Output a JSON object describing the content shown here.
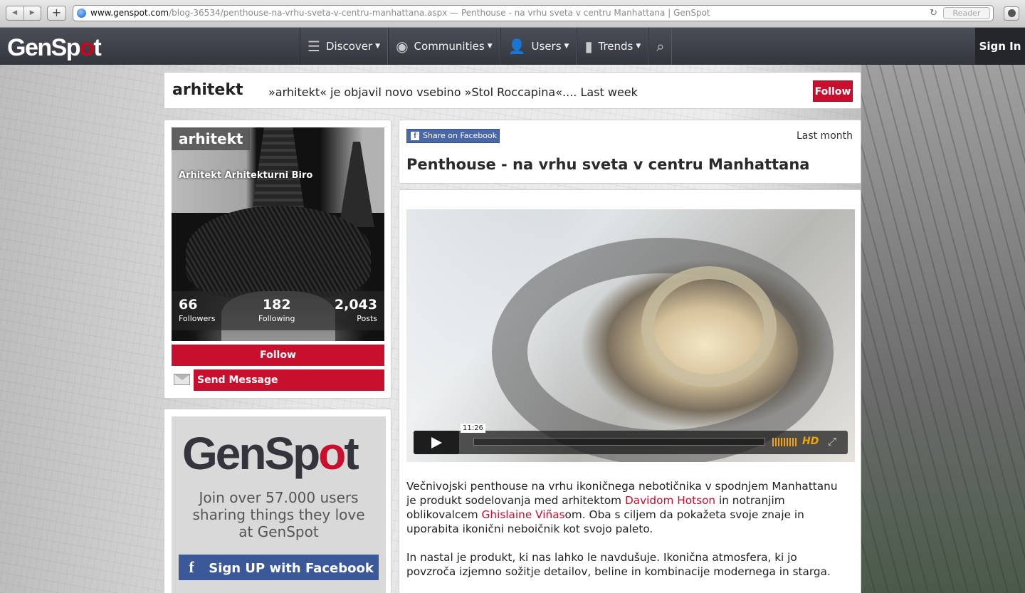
{
  "browser": {
    "url_host": "www.genspot.com",
    "url_rest": "/blog-36534/penthouse-na-vrhu-sveta-v-centru-manhattana.aspx — Penthouse - na vrhu sveta v centru Manhattana | GenSpot",
    "reader_label": "Reader"
  },
  "site_nav": {
    "logo": "GenSpot",
    "items": [
      {
        "label": "Discover",
        "icon": "menu-icon"
      },
      {
        "label": "Communities",
        "icon": "circle-icon"
      },
      {
        "label": "Users",
        "icon": "user-icon"
      },
      {
        "label": "Trends",
        "icon": "bar-chart-icon"
      }
    ],
    "search_icon": "search-icon",
    "signin_label": "Sign In"
  },
  "topbar": {
    "name": "arhitekt",
    "activity": "»arhitekt« je objavil novo vsebino »Stol Roccapina«.... Last week",
    "follow_label": "Follow"
  },
  "profile": {
    "name": "arhitekt",
    "tags": "Arhitekt  Arhitekturni Biro",
    "followers": "66",
    "followers_label": "Followers",
    "following": "182",
    "following_label": "Following",
    "posts": "2,043",
    "posts_label": "Posts",
    "follow_label": "Follow",
    "message_label": "Send Message"
  },
  "promo": {
    "logo": "GenSpot",
    "line1": "Join over 57.000 users",
    "line2": "sharing things they love",
    "line3": "at GenSpot",
    "signup_label": "Sign UP with Facebook"
  },
  "article": {
    "share_label": "Share on Facebook",
    "time": "Last month",
    "title": "Penthouse - na vrhu sveta v centru Manhattana",
    "video": {
      "time": "11:26",
      "hd_label": "HD"
    },
    "p1": {
      "t1": "Večnivojski penthouse na vrhu ikoničnega nebotičnika v spodnjem Manhattanu je produkt sodelovanja med arhitektom ",
      "link1": "Davidom Hotson",
      "t2": " in notranjim oblikovalcem ",
      "link2": "Ghislaine Viñas",
      "t3": "om. Oba s ciljem da pokažeta svoje znaje in uporabita ikonični neboičnik kot svojo paleto."
    },
    "p2": "In nastal je produkt, ki nas lahko le navdušuje. Ikonična atmosfera, ki jo povzroča izjemno sožitje detailov, beline in kombinacije modernega in starga."
  }
}
